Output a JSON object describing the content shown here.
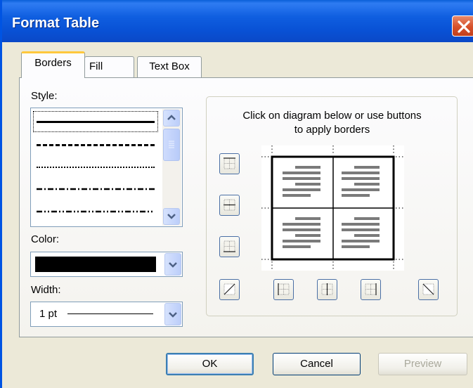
{
  "window": {
    "title": "Format Table"
  },
  "tabs": [
    {
      "label": "Borders",
      "active": true
    },
    {
      "label": "Fill",
      "active": false
    },
    {
      "label": "Text Box",
      "active": false
    }
  ],
  "style": {
    "label": "Style:",
    "options": [
      "solid",
      "dashed",
      "dotted",
      "dash-dot",
      "dash-dot-dot"
    ],
    "selected": "solid"
  },
  "color": {
    "label": "Color:",
    "value": "#000000"
  },
  "width": {
    "label": "Width:",
    "value": "1 pt"
  },
  "border_panel": {
    "instructions_line1": "Click on diagram below or use buttons",
    "instructions_line2": "to apply borders"
  },
  "buttons": {
    "ok": "OK",
    "cancel": "Cancel",
    "preview": "Preview"
  },
  "colors": {
    "title_bar": "#0a5fd8",
    "dialog_bg": "#ece9d8",
    "close_button": "#d6502a"
  }
}
